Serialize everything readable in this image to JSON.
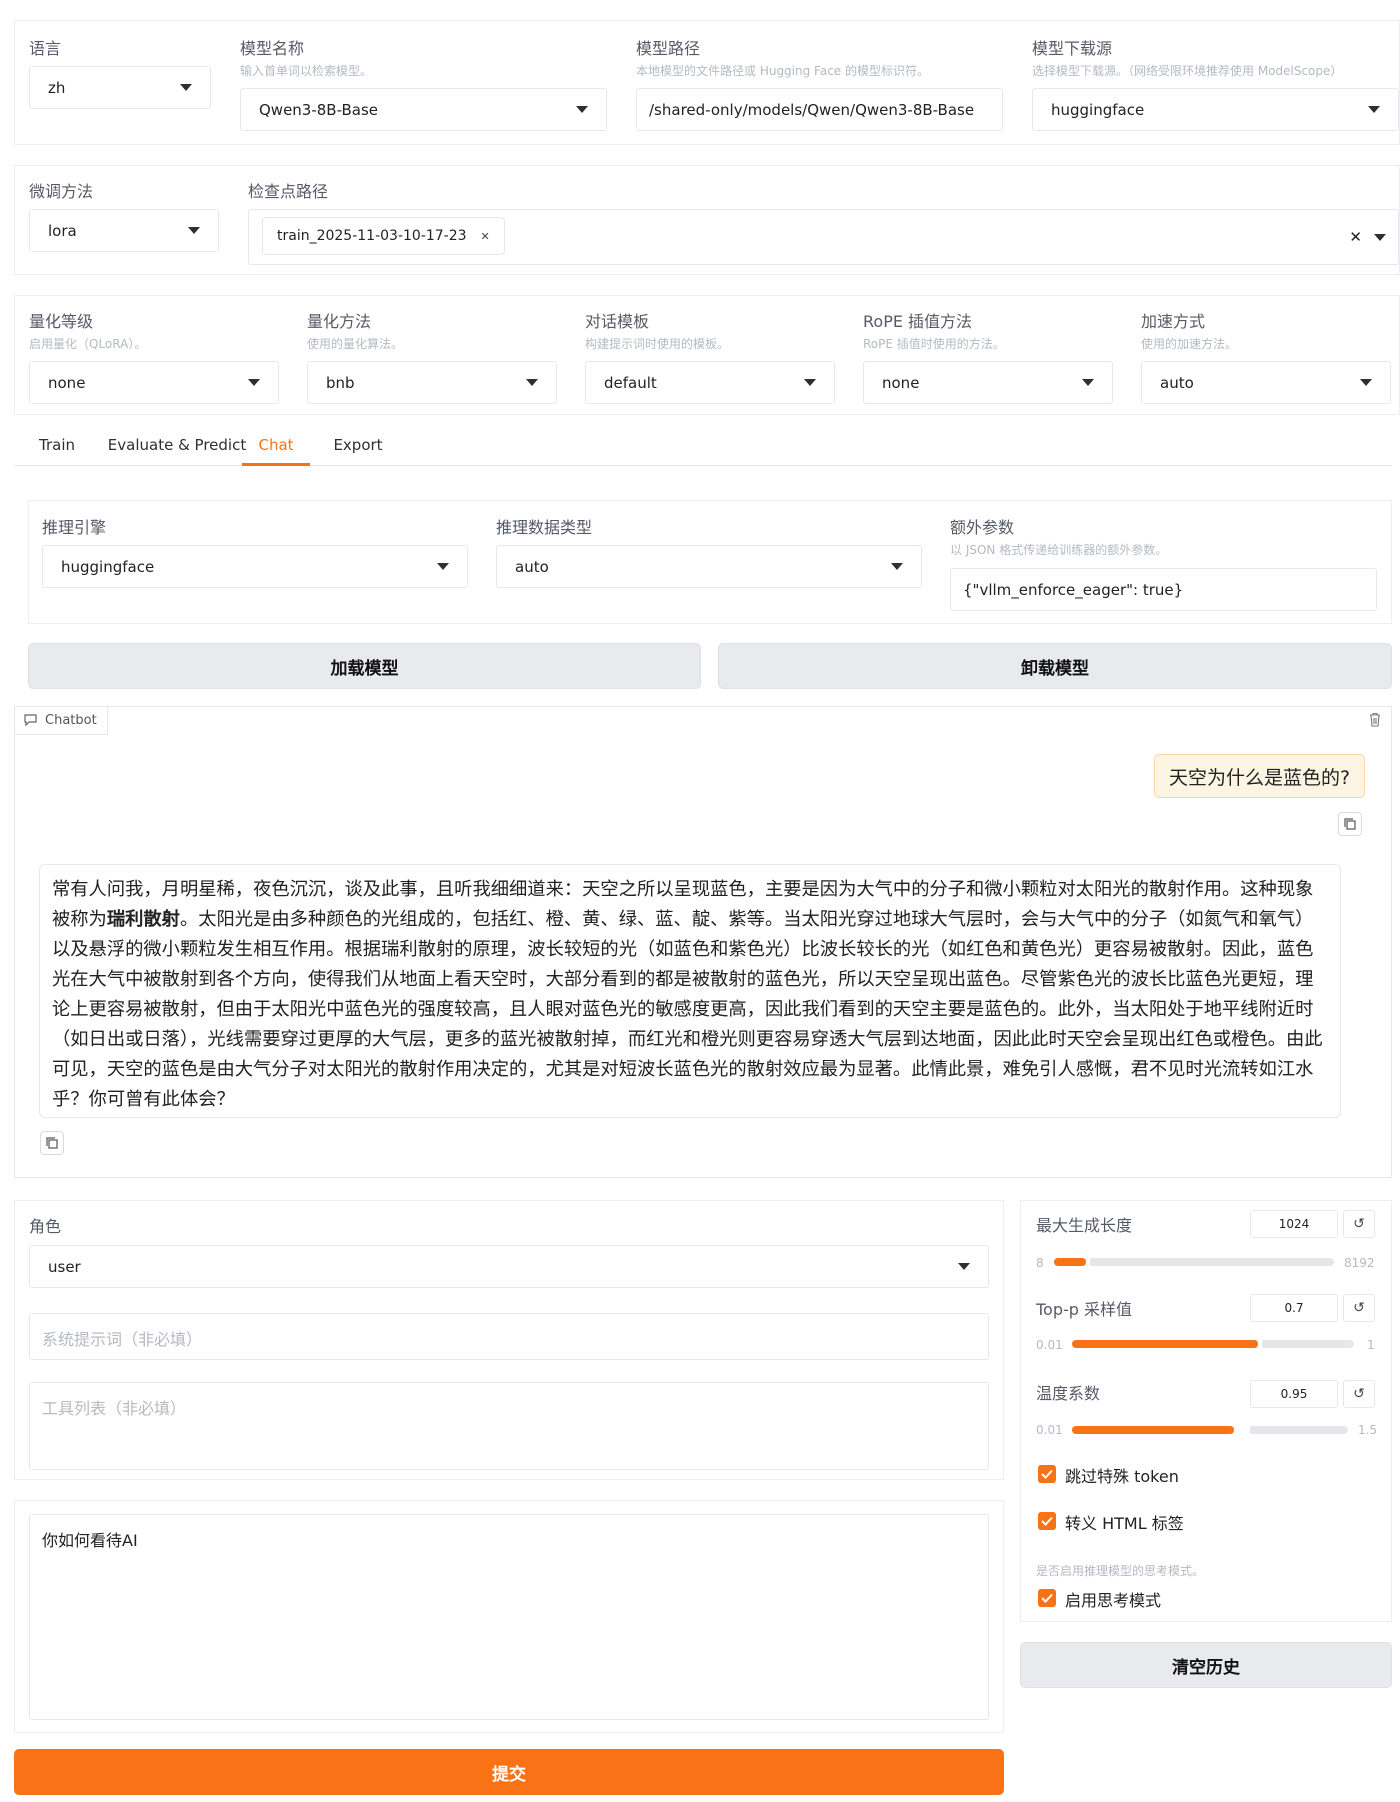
{
  "top_row": {
    "lang_label": "语言",
    "lang_value": "zh",
    "model_name_label": "模型名称",
    "model_name_hint": "输入首单词以检索模型。",
    "model_name_value": "Qwen3-8B-Base",
    "model_path_label": "模型路径",
    "model_path_hint": "本地模型的文件路径或 Hugging Face 的模型标识符。",
    "model_path_value": "/shared-only/models/Qwen/Qwen3-8B-Base",
    "hub_label": "模型下载源",
    "hub_hint": "选择模型下载源。（网络受限环境推荐使用 ModelScope）",
    "hub_value": "huggingface"
  },
  "finetune_row": {
    "method_label": "微调方法",
    "method_value": "lora",
    "ckpt_label": "检查点路径",
    "ckpt_chip": "train_2025-11-03-10-17-23"
  },
  "advanced_row": {
    "quant_bit_label": "量化等级",
    "quant_bit_hint": "启用量化（QLoRA）。",
    "quant_bit_value": "none",
    "quant_method_label": "量化方法",
    "quant_method_hint": "使用的量化算法。",
    "quant_method_value": "bnb",
    "template_label": "对话模板",
    "template_hint": "构建提示词时使用的模板。",
    "template_value": "default",
    "rope_label": "RoPE 插值方法",
    "rope_hint": "RoPE 插值时使用的方法。",
    "rope_value": "none",
    "booster_label": "加速方式",
    "booster_hint": "使用的加速方法。",
    "booster_value": "auto"
  },
  "tabs": [
    "Train",
    "Evaluate & Predict",
    "Chat",
    "Export"
  ],
  "active_tab": "Chat",
  "infer": {
    "backend_label": "推理引擎",
    "backend_value": "huggingface",
    "dtype_label": "推理数据类型",
    "dtype_value": "auto",
    "extra_label": "额外参数",
    "extra_hint": "以 JSON 格式传递给训练器的额外参数。",
    "extra_value": "{\"vllm_enforce_eager\": true}",
    "load_btn": "加载模型",
    "unload_btn": "卸载模型"
  },
  "chatbot": {
    "tag": "Chatbot",
    "user_msg": "天空为什么是蓝色的?",
    "bot_pre": "常有人问我，月明星稀，夜色沉沉，谈及此事，且听我细细道来：天空之所以呈现蓝色，主要是因为大气中的分子和微小颗粒对太阳光的散射作用。这种现象被称为",
    "bot_bold": "瑞利散射",
    "bot_post": "。太阳光是由多种颜色的光组成的，包括红、橙、黄、绿、蓝、靛、紫等。当太阳光穿过地球大气层时，会与大气中的分子（如氮气和氧气）以及悬浮的微小颗粒发生相互作用。根据瑞利散射的原理，波长较短的光（如蓝色和紫色光）比波长较长的光（如红色和黄色光）更容易被散射。因此，蓝色光在大气中被散射到各个方向，使得我们从地面上看天空时，大部分看到的都是被散射的蓝色光，所以天空呈现出蓝色。尽管紫色光的波长比蓝色光更短，理论上更容易被散射，但由于太阳光中蓝色光的强度较高，且人眼对蓝色光的敏感度更高，因此我们看到的天空主要是蓝色的。此外，当太阳处于地平线附近时（如日出或日落），光线需要穿过更厚的大气层，更多的蓝光被散射掉，而红光和橙光则更容易穿透大气层到达地面，因此此时天空会呈现出红色或橙色。由此可见，天空的蓝色是由大气分子对太阳光的散射作用决定的，尤其是对短波长蓝色光的散射效应最为显著。此情此景，难免引人感慨，君不见时光流转如江水乎？你可曾有此体会？"
  },
  "input": {
    "role_label": "角色",
    "role_value": "user",
    "system_placeholder": "系统提示词（非必填）",
    "tools_placeholder": "工具列表（非必填）",
    "query_value": "你如何看待AI",
    "submit_btn": "提交"
  },
  "gen": {
    "max_new_tokens_label": "最大生成长度",
    "max_new_tokens": "1024",
    "max_new_tokens_min": "8",
    "max_new_tokens_max": "8192",
    "top_p_label": "Top-p 采样值",
    "top_p": "0.7",
    "top_p_min": "0.01",
    "top_p_max": "1",
    "temperature_label": "温度系数",
    "temperature": "0.95",
    "temperature_min": "0.01",
    "temperature_max": "1.5",
    "skip_special_label": "跳过特殊 token",
    "escape_html_label": "转义 HTML 标签",
    "thinking_hint": "是否启用推理模型的思考模式。",
    "thinking_label": "启用思考模式",
    "clear_btn": "清空历史"
  },
  "colors": {
    "accent": "#f97316",
    "user_bubble": "#fdf5e3"
  },
  "icons": [
    "chevron-down-icon",
    "clear-x-icon",
    "chat-icon",
    "trash-icon",
    "copy-icon",
    "reset-icon",
    "checkmark-icon"
  ]
}
